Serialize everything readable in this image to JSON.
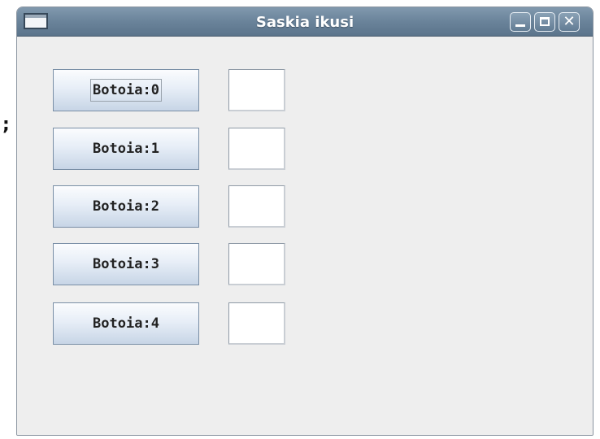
{
  "stray_text": ";",
  "window": {
    "title": "Saskia ikusi",
    "icon": "window-icon",
    "controls": {
      "minimize": "minimize-icon",
      "maximize": "maximize-icon",
      "close": "close-icon",
      "close_glyph": "✕"
    }
  },
  "rows": [
    {
      "button_label": "Botoia:0",
      "field_value": ""
    },
    {
      "button_label": "Botoia:1",
      "field_value": ""
    },
    {
      "button_label": "Botoia:2",
      "field_value": ""
    },
    {
      "button_label": "Botoia:3",
      "field_value": ""
    },
    {
      "button_label": "Botoia:4",
      "field_value": ""
    }
  ],
  "colors": {
    "titlebar": "#6a839a",
    "window_bg": "#eeeeee",
    "button_border": "#7a8fa6"
  }
}
